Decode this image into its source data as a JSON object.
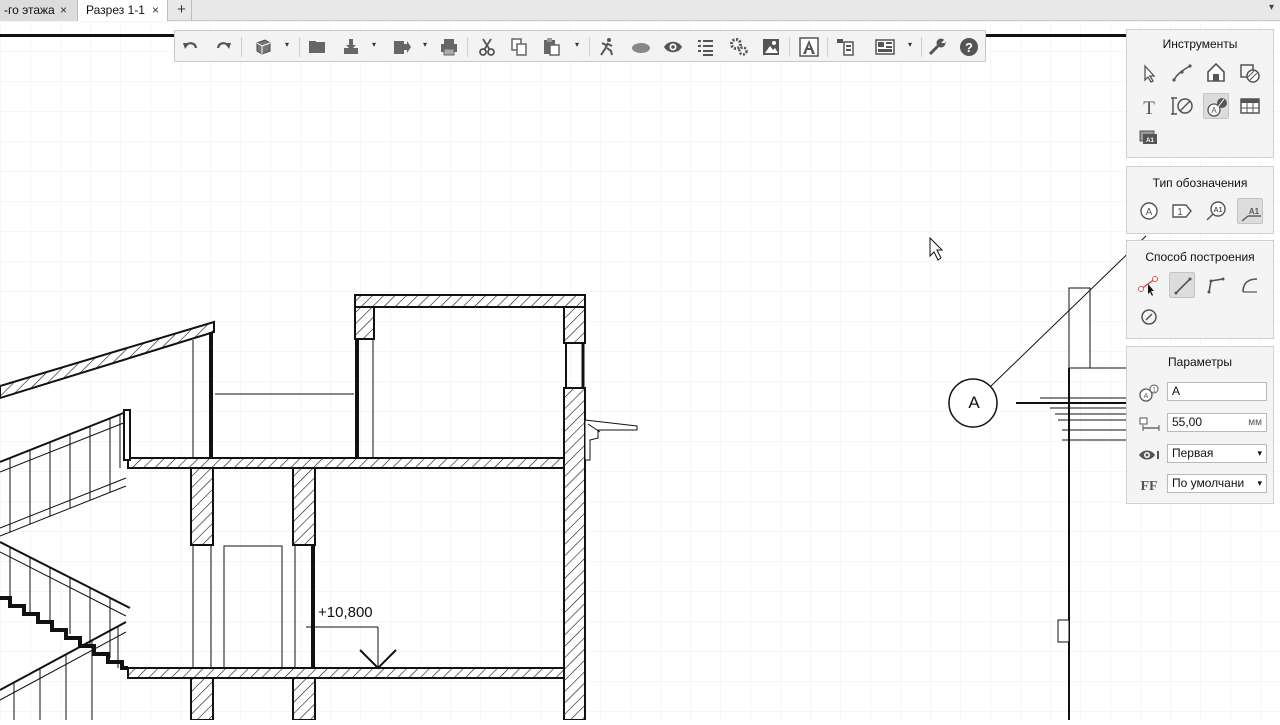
{
  "tabs": [
    {
      "label": "-го этажа",
      "close": "×"
    },
    {
      "label": "Разрез 1-1",
      "close": "×",
      "active": true
    }
  ],
  "tab_add": "+",
  "tab_menu": "▾",
  "toolbar": {
    "icons": [
      "undo-icon",
      "redo-icon",
      "3d-view-icon",
      "open-folder-icon",
      "import-icon",
      "export-icon",
      "print-icon",
      "cut-icon",
      "copy-icon",
      "paste-icon",
      "walk-icon",
      "material-icon",
      "visibility-icon",
      "list-icon",
      "settings-gears-icon",
      "image-icon",
      "text-style-icon",
      "layout-icon",
      "sheets-icon",
      "wrench-icon",
      "help-icon"
    ],
    "dropdown_arrow": "▾"
  },
  "panels": {
    "tools": {
      "title": "Инструменты",
      "icons": [
        "pointer-icon",
        "line-icon",
        "3d-shape-icon",
        "hatch-icon",
        "text-icon",
        "dimension-icon",
        "axis-mark-icon",
        "table-icon",
        "layer-mark-icon"
      ]
    },
    "mark_type": {
      "title": "Тип обозначения",
      "icons": [
        "circle-a-icon",
        "tag-1-icon",
        "leader-a1-icon",
        "underline-a1-icon"
      ]
    },
    "build_method": {
      "title": "Способ построения",
      "icons": [
        "point-pick-icon",
        "straight-line-icon",
        "polyline-icon",
        "arc-line-icon",
        "angle-icon"
      ]
    },
    "params": {
      "title": "Параметры",
      "mark_value": "A",
      "offset_value": "55,00",
      "offset_unit": "мм",
      "visibility_value": "Первая",
      "font_value": "По умолчани",
      "dropdown_arrow": "▾"
    }
  },
  "drawing": {
    "elevation_mark": "+10,800",
    "axis_mark": "A"
  },
  "colors": {
    "selected_bg": "#dcdcdc",
    "panel_bg": "#f4f4f4",
    "toolbar_bg": "#f3f3f3",
    "grid": "#ececec"
  }
}
